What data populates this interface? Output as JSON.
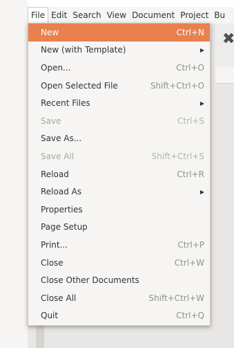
{
  "menubar": {
    "items": [
      "File",
      "Edit",
      "Search",
      "View",
      "Document",
      "Project",
      "Bu"
    ]
  },
  "file_menu": {
    "items": [
      {
        "label": "New",
        "shortcut": "Ctrl+N"
      },
      {
        "label": "New (with Template)",
        "shortcut": ""
      },
      {
        "label": "Open...",
        "shortcut": "Ctrl+O"
      },
      {
        "label": "Open Selected File",
        "shortcut": "Shift+Ctrl+O"
      },
      {
        "label": "Recent Files",
        "shortcut": ""
      },
      {
        "label": "Save",
        "shortcut": "Ctrl+S"
      },
      {
        "label": "Save As...",
        "shortcut": ""
      },
      {
        "label": "Save All",
        "shortcut": "Shift+Ctrl+S"
      },
      {
        "label": "Reload",
        "shortcut": "Ctrl+R"
      },
      {
        "label": "Reload As",
        "shortcut": ""
      },
      {
        "label": "Properties",
        "shortcut": ""
      },
      {
        "label": "Page Setup",
        "shortcut": ""
      },
      {
        "label": "Print...",
        "shortcut": "Ctrl+P"
      },
      {
        "label": "Close",
        "shortcut": "Ctrl+W"
      },
      {
        "label": "Close Other Documents",
        "shortcut": ""
      },
      {
        "label": "Close All",
        "shortcut": "Shift+Ctrl+W"
      },
      {
        "label": "Quit",
        "shortcut": "Ctrl+Q"
      }
    ]
  },
  "colors": {
    "highlight": "#e8814d",
    "menu_bg": "#f6f5f4",
    "disabled_text": "#a5a6a4"
  },
  "icons": {
    "submenu_arrow": "triangle-right-icon",
    "background_close": "close-icon"
  }
}
